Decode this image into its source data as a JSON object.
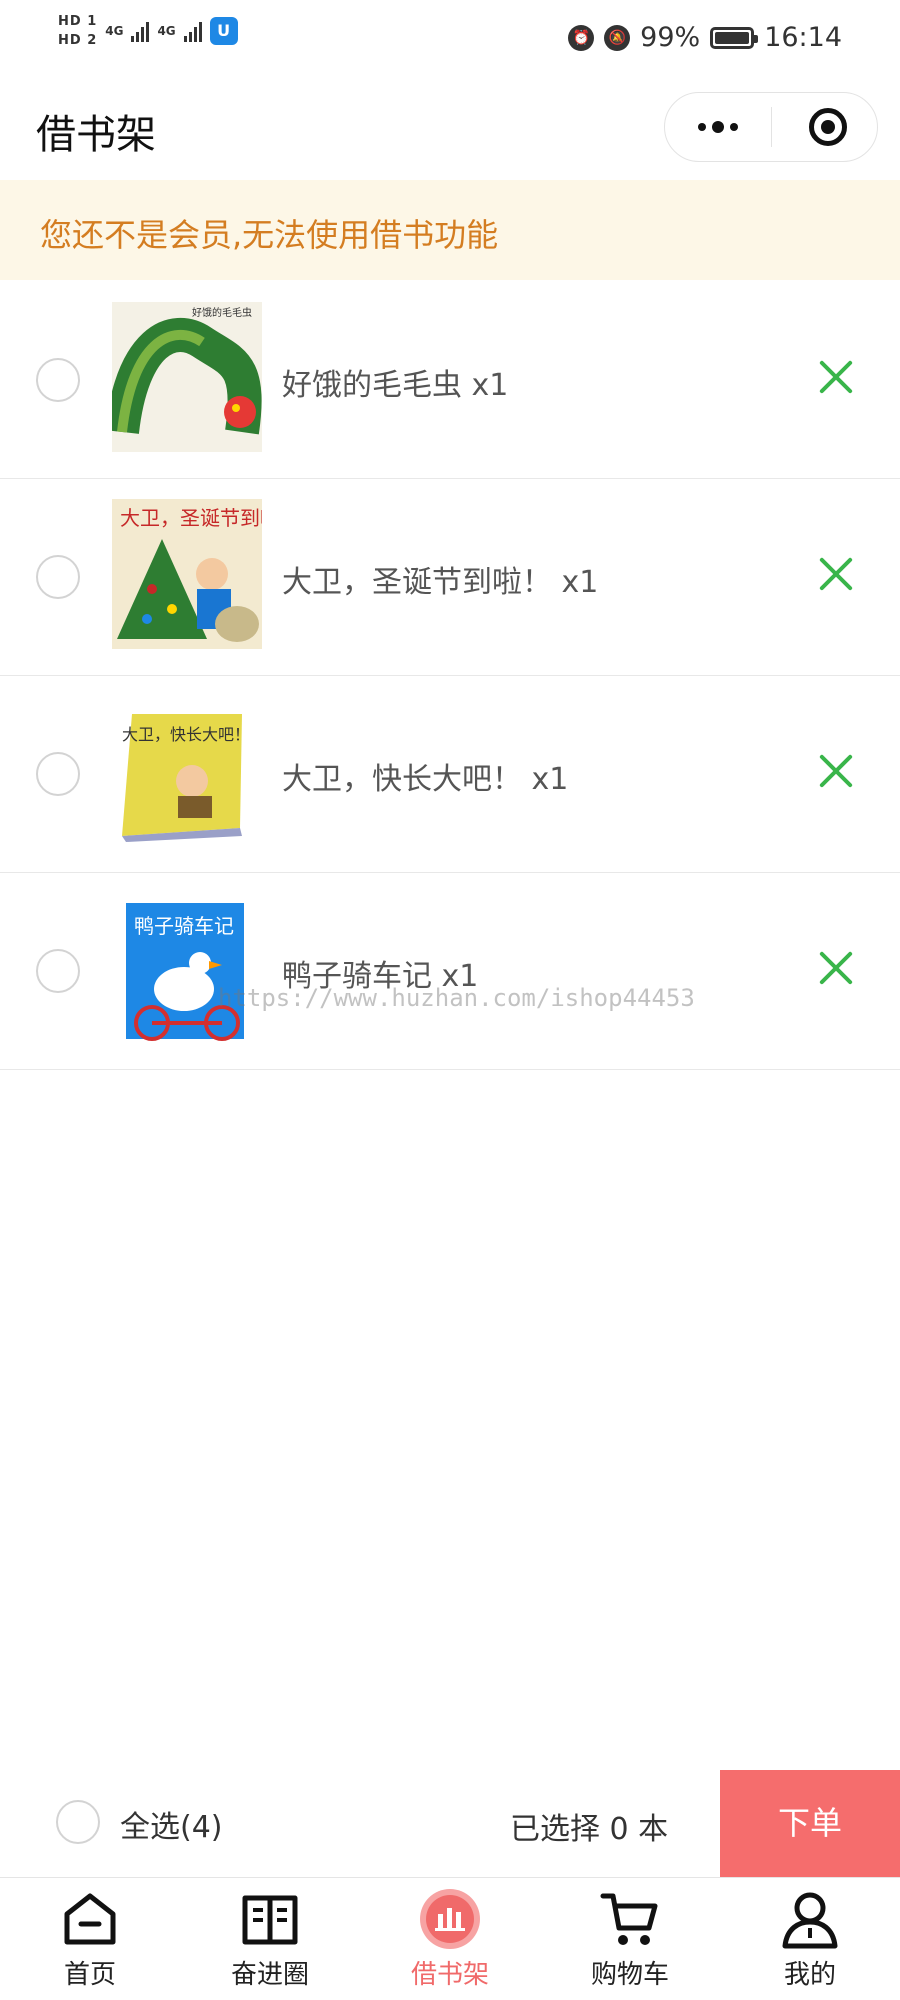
{
  "status_bar": {
    "sim1": "HD 1",
    "sim2": "HD 2",
    "network1": "4G",
    "network2": "4G",
    "app_badge": "U",
    "battery_percent": "99%",
    "time": "16:14"
  },
  "header": {
    "title": "借书架"
  },
  "notice": {
    "text": "您还不是会员,无法使用借书功能"
  },
  "books": [
    {
      "name": "好饿的毛毛虫 x1",
      "cover_title": "好饿的毛毛虫",
      "cover_colors": [
        "#2e7d32",
        "#e53935"
      ]
    },
    {
      "name": "大卫，圣诞节到啦！ x1",
      "cover_title": "大卫，圣诞节到啦！",
      "cover_colors": [
        "#2e7d32",
        "#c62828"
      ]
    },
    {
      "name": "大卫，快长大吧！ x1",
      "cover_title": "大卫，快长大吧！",
      "cover_colors": [
        "#e6d94a",
        "#7a5b2b"
      ]
    },
    {
      "name": "鸭子骑车记 x1",
      "cover_title": "鸭子骑车记",
      "cover_colors": [
        "#1e88e5",
        "#d32f2f"
      ]
    }
  ],
  "watermark": "https://www.huzhan.com/ishop44453",
  "footer": {
    "select_all_label": "全选(4)",
    "selected_text": "已选择 0 本",
    "order_label": "下单",
    "order_color": "#f56d6d"
  },
  "tabs": [
    {
      "label": "首页",
      "icon": "home-icon"
    },
    {
      "label": "奋进圈",
      "icon": "book-open-icon"
    },
    {
      "label": "借书架",
      "icon": "bookshelf-icon",
      "active": true
    },
    {
      "label": "购物车",
      "icon": "cart-icon"
    },
    {
      "label": "我的",
      "icon": "user-icon"
    }
  ],
  "colors": {
    "accent": "#f06a6a",
    "delete": "#39b54a",
    "notice_text": "#d47d21",
    "notice_bg": "#fdf7e7"
  }
}
